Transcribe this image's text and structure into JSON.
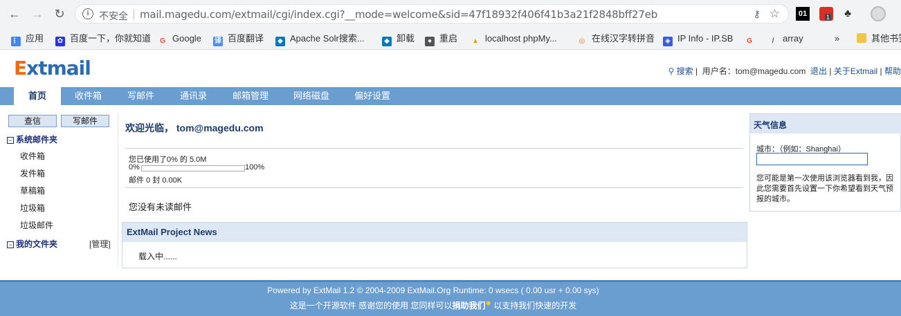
{
  "browser": {
    "insecure_label": "不安全",
    "url": "mail.magedu.com/extmail/cgi/index.cgi?__mode=welcome&sid=47f18932f406f41b3a21f2848bff27eb",
    "ext_01_label": "01",
    "ext_badge": "1",
    "bookmarks": [
      {
        "label": "应用",
        "icon": "apps-grid-icon",
        "color": "#4285f4"
      },
      {
        "label": "百度一下，你就知道",
        "icon": "baidu-paw-icon",
        "color": "#2932e1"
      },
      {
        "label": "Google",
        "icon": "google-g-icon",
        "color": "#ea4335"
      },
      {
        "label": "百度翻译",
        "icon": "baidu-translate-icon",
        "color": "#4e8ef7"
      },
      {
        "label": "Apache Solr搜索...",
        "icon": "drupal-drop-icon",
        "color": "#0678be"
      },
      {
        "label": "卸载",
        "icon": "drupal-drop-icon",
        "color": "#0678be"
      },
      {
        "label": "重启",
        "icon": "globe-icon",
        "color": "#555555"
      },
      {
        "label": "localhost phpMy...",
        "icon": "phpmyadmin-icon",
        "color": "#f89c0e"
      },
      {
        "label": "在线汉字转拼音",
        "icon": "swirl-icon",
        "color": "#e67e22"
      },
      {
        "label": "IP Info - IP.SB",
        "icon": "shield-icon",
        "color": "#3b5bdb"
      },
      {
        "label": "",
        "icon": "google-g-icon",
        "color": "#ea4335"
      },
      {
        "label": "array",
        "icon": "slash-icon",
        "color": "#555555"
      }
    ],
    "more_bookmarks": "»",
    "other_bookmarks": "其他书签"
  },
  "header": {
    "logo_e": "E",
    "logo_rest": "xtmail",
    "search_label": "搜索",
    "separator": "|",
    "username_label": "用户名：tom@magedu.com",
    "logout_label": "退出",
    "about_label": "关于Extmail",
    "help_label": "帮助"
  },
  "tabs": [
    {
      "label": "首页",
      "active": true
    },
    {
      "label": "收件箱"
    },
    {
      "label": "写邮件"
    },
    {
      "label": "通讯录"
    },
    {
      "label": "邮箱管理"
    },
    {
      "label": "网络磁盘"
    },
    {
      "label": "偏好设置"
    }
  ],
  "sidebar": {
    "check_mail_button": "查信",
    "compose_button": "写邮件",
    "system_folders_title": "系统邮件夹",
    "system_folders": [
      "收件箱",
      "发件箱",
      "草稿箱",
      "垃圾箱",
      "垃圾邮件"
    ],
    "my_folders_title": "我的文件夹",
    "manage_label": "[管理]",
    "collapse_symbol": "−"
  },
  "main": {
    "welcome": "欢迎光临， tom@magedu.com",
    "usage_text": "您已使用了0% 的 5.0M",
    "usage_min": "0%",
    "usage_max": "100%",
    "usage_fraction": 0,
    "mail_count": "邮件 0 封 0.00K",
    "no_unread": "您没有未读邮件",
    "news_title": "ExtMail Project News",
    "news_loading": "载入中......"
  },
  "weather": {
    "title": "天气信息",
    "city_label": "城市：（例如：Shanghai）",
    "city_value": "",
    "note": "您可能是第一次使用该浏览器看到我，因此您需要首先设置一下你希望看到天气预报的城市。"
  },
  "footer": {
    "line1": "Powered by ExtMail 1.2 © 2004-2009 ExtMail.Org Runtime: 0 wsecs ( 0.00 usr + 0.00 sys)",
    "line2_a": "这是一个开源软件 感谢您的使用 您同样可以",
    "donate_label": "捐助我们",
    "line2_b": " 以支持我们快速的开发"
  },
  "colors": {
    "tab_bar": "#6a9dd0",
    "logo_orange": "#f26a10",
    "logo_blue": "#2a6cb8",
    "panel_header": "#dde8f4"
  }
}
